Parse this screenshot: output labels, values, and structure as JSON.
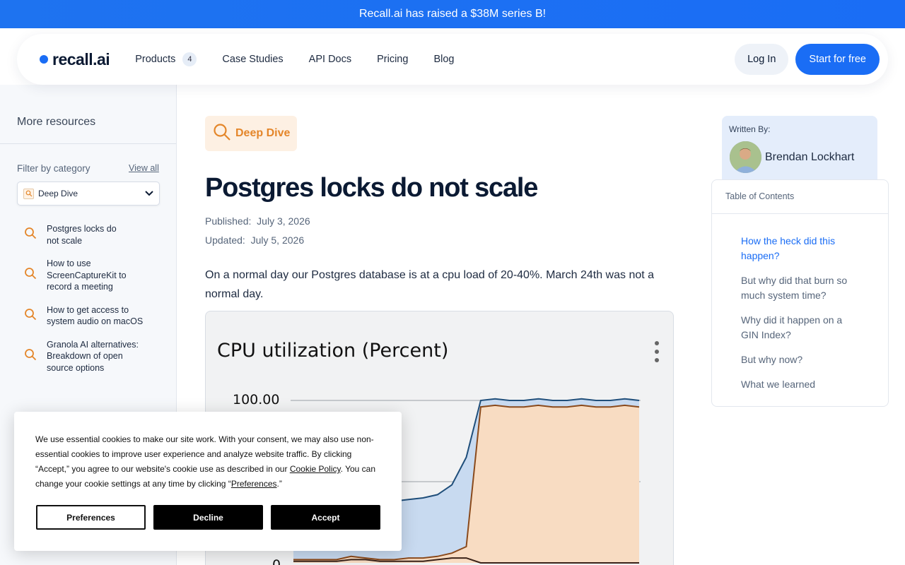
{
  "announcement": "Recall.ai has raised a $38M series B!",
  "header": {
    "logo_text": "recall.ai",
    "nav": [
      {
        "label": "Products",
        "badge": "4"
      },
      {
        "label": "Case Studies"
      },
      {
        "label": "API Docs"
      },
      {
        "label": "Pricing"
      },
      {
        "label": "Blog"
      }
    ],
    "login_label": "Log In",
    "start_label": "Start for free"
  },
  "sidebar": {
    "title": "More resources",
    "filter_label": "Filter by category",
    "view_all": "View all",
    "selected_category": "Deep Dive",
    "resources": [
      {
        "title": "Postgres locks do not scale"
      },
      {
        "title": "How to use ScreenCaptureKit to record a meeting"
      },
      {
        "title": "How to get access to system audio on macOS"
      },
      {
        "title": "Granola AI alternatives: Breakdown of open source options"
      }
    ]
  },
  "article": {
    "tag": "Deep Dive",
    "title": "Postgres locks do not scale",
    "published_label": "Published:",
    "published_date": "July 3, 2026",
    "updated_label": "Updated:",
    "updated_date": "July 5, 2026",
    "intro": "On a normal day our Postgres database is at a cpu load of 20-40%. March 24th was not a normal day."
  },
  "chart_data": {
    "type": "area",
    "title": "CPU utilization (Percent)",
    "ytick_labels": [
      "100.00",
      "0"
    ],
    "ylim": [
      0,
      100
    ],
    "series": [
      {
        "values": [
          38,
          38,
          38,
          38,
          39,
          40,
          38,
          38,
          39,
          40,
          42,
          48,
          65,
          100,
          101,
          100,
          100,
          101,
          100,
          100,
          101,
          100,
          100,
          101,
          100
        ]
      },
      {
        "values": [
          2,
          2,
          2,
          2,
          4,
          3,
          2,
          2,
          3,
          3,
          4,
          6,
          10,
          96,
          97,
          96,
          96,
          97,
          96,
          96,
          97,
          96,
          96,
          97,
          96
        ]
      },
      {
        "values": [
          1,
          1,
          1,
          1,
          2,
          2,
          1,
          1,
          1,
          1,
          2,
          3,
          3,
          0,
          0,
          0,
          0,
          0,
          0,
          0,
          0,
          0,
          0,
          0,
          0
        ]
      }
    ],
    "colors": {
      "total": "#1f4e7a",
      "total_fill": "#c8daf0",
      "user": "#8a4a1c",
      "user_fill": "#f8dcc2",
      "sys": "#3a2218"
    }
  },
  "author": {
    "label": "Written By:",
    "name": "Brendan Lockhart"
  },
  "toc": {
    "title": "Table of Contents",
    "items": [
      "How the heck did this happen?",
      "But why did that burn so much system time?",
      "Why did it happen on a GIN Index?",
      "But why now?",
      "What we learned"
    ]
  },
  "cookie": {
    "text_1": "We use essential cookies to make our site work. With your consent, we may also use non-essential cookies to improve user experience and analyze website traffic. By clicking “Accept,” you agree to our website's cookie use as described in our ",
    "policy_link": "Cookie Policy",
    "text_2": ". You can change your cookie settings at any time by clicking “",
    "prefs_link": "Preferences",
    "text_3": ".”",
    "preferences_label": "Preferences",
    "decline_label": "Decline",
    "accept_label": "Accept"
  }
}
